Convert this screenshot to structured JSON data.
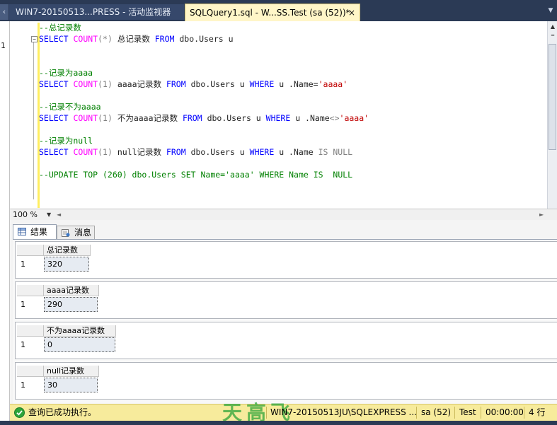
{
  "tabs": {
    "tab1_title": "WIN7-20150513...PRESS - 活动监视器",
    "tab2_title": "SQLQuery1.sql - W...SS.Test (sa (52))*",
    "close_glyph": "×"
  },
  "left_panel": {
    "line_marker": "1"
  },
  "editor": {
    "lines": [
      {
        "comment": "--总记录数"
      },
      {
        "kw1": "SELECT",
        "fn": "COUNT",
        "args": "(*)",
        "alias": " 总记录数 ",
        "kw2": "FROM",
        "obj": " dbo.Users u"
      },
      {
        "comment": "--记录为aaaa"
      },
      {
        "kw1": "SELECT",
        "fn": "COUNT",
        "args": "(1)",
        "alias": " aaaa记录数 ",
        "kw2": "FROM",
        "obj": " dbo.Users u ",
        "kw3": "WHERE",
        "cond": " u .Name=",
        "str": "'aaaa'"
      },
      {
        "comment": "--记录不为aaaa"
      },
      {
        "kw1": "SELECT",
        "fn": "COUNT",
        "args": "(1)",
        "alias": " 不为aaaa记录数 ",
        "kw2": "FROM",
        "obj": " dbo.Users u ",
        "kw3": "WHERE",
        "cond": " u .Name",
        "op": "<>",
        "str": "'aaaa'"
      },
      {
        "comment": "--记录为null"
      },
      {
        "kw1": "SELECT",
        "fn": "COUNT",
        "args": "(1)",
        "alias": " null记录数 ",
        "kw2": "FROM",
        "obj": " dbo.Users u ",
        "kw3": "WHERE",
        "cond": " u .Name ",
        "g1": "IS",
        "g2": " NULL"
      },
      {
        "comment": "--UPDATE TOP (260) dbo.Users SET Name='aaaa' WHERE Name IS  NULL"
      }
    ],
    "collapse_glyph": "−"
  },
  "zoom": {
    "value": "100 %",
    "dropdown_glyph": "▼",
    "left_glyph": "◄",
    "right_glyph": "►"
  },
  "scroll": {
    "up_glyph": "▲",
    "down_glyph": "▼"
  },
  "results": {
    "tab_results": "结果",
    "tab_messages": "消息",
    "grids": [
      {
        "column": "总记录数",
        "row": "1",
        "value": "320"
      },
      {
        "column": "aaaa记录数",
        "row": "1",
        "value": "290"
      },
      {
        "column": "不为aaaa记录数",
        "row": "1",
        "value": "0"
      },
      {
        "column": "null记录数",
        "row": "1",
        "value": "30"
      }
    ]
  },
  "status": {
    "message": "查询已成功执行。",
    "server": "WIN7-20150513JU\\SQLEXPRESS ...",
    "user": "sa (52)",
    "database": "Test",
    "time": "00:00:00",
    "rows": "4 行",
    "watermark": "天高飞",
    "ok_color": "#2ea53a"
  }
}
